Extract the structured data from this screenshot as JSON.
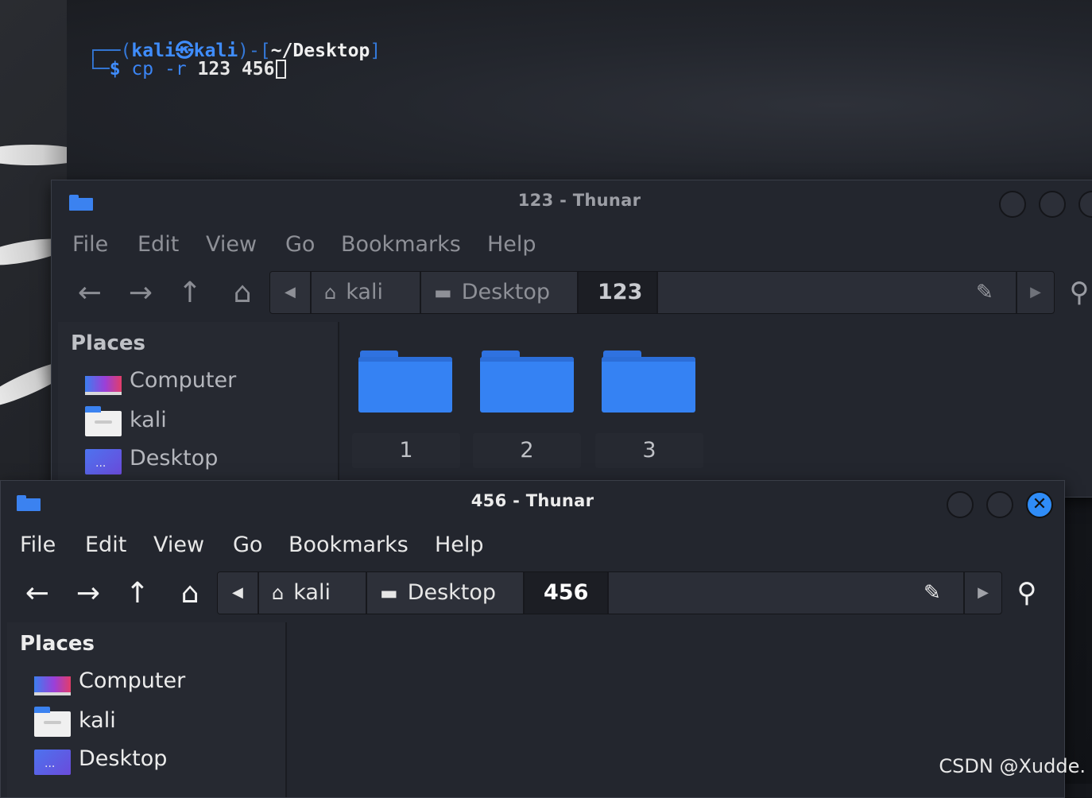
{
  "terminal": {
    "user": "kali",
    "host": "kali",
    "at_symbol": "㉿",
    "cwd": "~/Desktop",
    "prompt_symbol": "$",
    "command": "cp",
    "flag": "-r",
    "arg1": "123",
    "arg2": "456"
  },
  "window_back": {
    "title": "123 - Thunar",
    "menu": [
      "File",
      "Edit",
      "View",
      "Go",
      "Bookmarks",
      "Help"
    ],
    "path": [
      "kali",
      "Desktop",
      "123"
    ],
    "places_heading": "Places",
    "places": [
      "Computer",
      "kali",
      "Desktop"
    ],
    "items": [
      "1",
      "2",
      "3"
    ]
  },
  "window_front": {
    "title": "456 - Thunar",
    "menu": [
      "File",
      "Edit",
      "View",
      "Go",
      "Bookmarks",
      "Help"
    ],
    "path": [
      "kali",
      "Desktop",
      "456"
    ],
    "places_heading": "Places",
    "places": [
      "Computer",
      "kali",
      "Desktop"
    ],
    "close_glyph": "✕"
  },
  "icons": {
    "back": "←",
    "forward": "→",
    "up": "↑",
    "home": "⌂",
    "left_caret": "◀",
    "right_caret": "▶",
    "pencil": "✎",
    "search": "⚲",
    "drive": "▬"
  },
  "colors": {
    "accent": "#3582f3",
    "window_bg": "#23262e",
    "terminal_prompt": "#3f8dff"
  },
  "watermark": "CSDN @Xudde."
}
